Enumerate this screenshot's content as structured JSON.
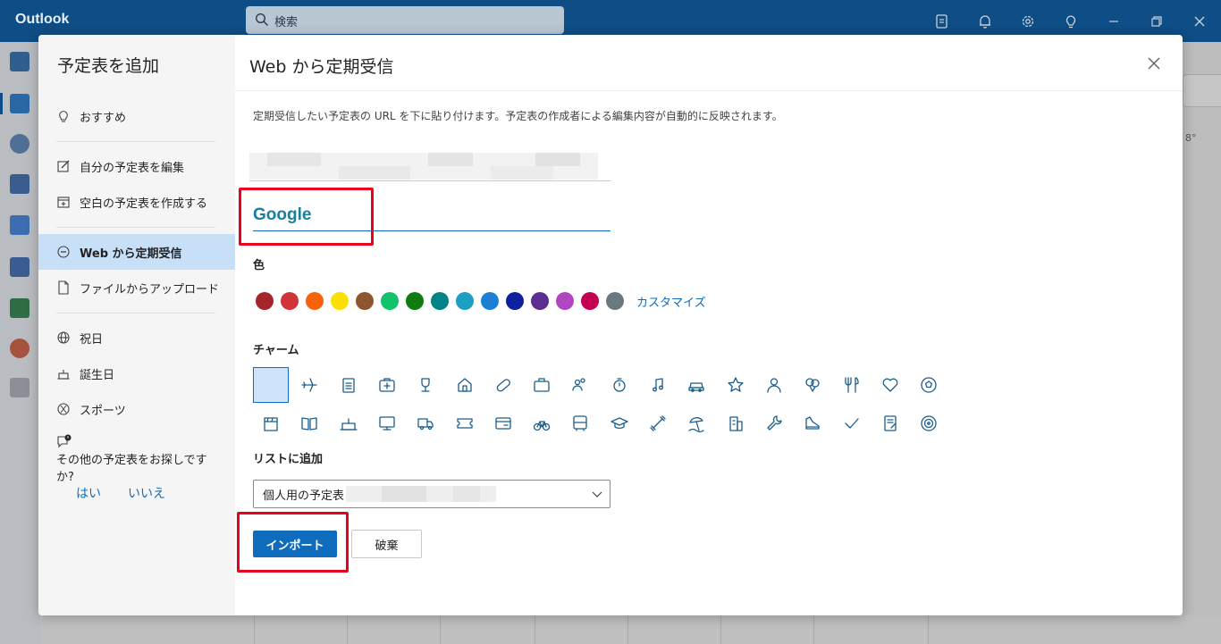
{
  "app": {
    "title": "Outlook"
  },
  "search": {
    "placeholder": "検索"
  },
  "topbar_icons": [
    "note-icon",
    "bell-icon",
    "gear-icon",
    "lightbulb-icon",
    "minimize-icon",
    "restore-icon",
    "close-icon"
  ],
  "background": {
    "weather": "8°"
  },
  "sidebar": {
    "title": "予定表を追加",
    "items": [
      {
        "label": "おすすめ",
        "icon": "lightbulb-icon",
        "selected": false
      },
      {
        "label": "自分の予定表を編集",
        "icon": "edit-icon",
        "selected": false
      },
      {
        "label": "空白の予定表を作成する",
        "icon": "calendar-add-icon",
        "selected": false
      },
      {
        "label": "Web から定期受信",
        "icon": "link-icon",
        "selected": true
      },
      {
        "label": "ファイルからアップロード",
        "icon": "document-icon",
        "selected": false
      },
      {
        "label": "祝日",
        "icon": "globe-icon",
        "selected": false
      },
      {
        "label": "誕生日",
        "icon": "cake-icon",
        "selected": false
      },
      {
        "label": "スポーツ",
        "icon": "sports-icon",
        "selected": false
      }
    ],
    "find_more": {
      "text": "その他の予定表をお探しですか?",
      "yes": "はい",
      "no": "いいえ"
    }
  },
  "main": {
    "title": "Web から定期受信",
    "description": "定期受信したい予定表の URL を下に貼り付けます。予定表の作成者による編集内容が自動的に反映されます。",
    "calendar_name": "Google",
    "color_label": "色",
    "colors": [
      "#a4262c",
      "#d13438",
      "#f7630c",
      "#fce100",
      "#8e562e",
      "#13c26a",
      "#107c10",
      "#038387",
      "#1d9fc3",
      "#1c7fd6",
      "#0f1f9e",
      "#5c2e91",
      "#b146c2",
      "#c30052",
      "#69797e"
    ],
    "customize_label": "カスタマイズ",
    "charm_label": "チャーム",
    "charms": [
      "none",
      "airplane-icon",
      "clipboard-icon",
      "first-aid-icon",
      "trophy-icon",
      "home-icon",
      "pill-icon",
      "briefcase-icon",
      "people-icon",
      "stopwatch-icon",
      "music-icon",
      "car-icon",
      "star-icon",
      "person-icon",
      "balloon-icon",
      "cutlery-icon",
      "heart-icon",
      "soccer-ball-icon",
      "clapperboard-icon",
      "book-icon",
      "cake-icon",
      "desktop-icon",
      "truck-icon",
      "ticket-icon",
      "card-icon",
      "bicycle-icon",
      "bus-icon",
      "graduation-cap-icon",
      "dumbbell-icon",
      "beach-icon",
      "building-icon",
      "wrench-icon",
      "shoe-icon",
      "checkmark-icon",
      "notepad-icon",
      "target-icon"
    ],
    "add_to_label": "リストに追加",
    "add_to_value": "個人用の予定表",
    "import_label": "インポート",
    "discard_label": "破棄"
  },
  "colors": {
    "brand": "#0f6cbd",
    "topbar": "#0f4d86",
    "selected_nav": "#c7dff7",
    "highlight": "#e8001c"
  }
}
